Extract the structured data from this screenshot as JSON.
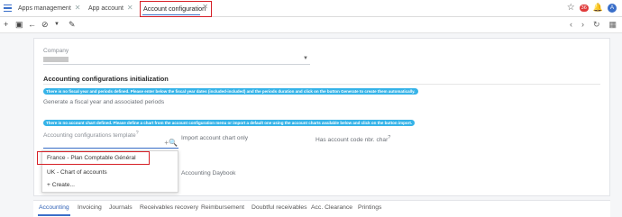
{
  "topbar": {
    "tabs": [
      {
        "label": "Apps management"
      },
      {
        "label": "App account"
      }
    ],
    "active_tab": {
      "label": "Account configuration"
    },
    "notification_count": "36",
    "avatar_initial": "A"
  },
  "form": {
    "company_label": "Company",
    "section_title": "Accounting configurations initialization",
    "info_fiscal": "There is no fiscal year and periods defined. Please enter below the fiscal year dates (included-included) and the periods duration and click on the button Generate to create them automatically.",
    "generate_label": "Generate a fiscal year and associated periods",
    "info_chart": "There is no account chart defined. Please define a chart from the account configuration menu or import a default one using the account charts available below and click on the button import.",
    "template_label": "Accounting configurations template",
    "template_help": "?",
    "import_label": "Import account chart only",
    "account_code_label": "Has account code nbr. char",
    "account_code_help": "?",
    "daybook_label": "Accounting Daybook"
  },
  "dropdown": {
    "options": [
      {
        "label": "France - Plan Comptable Général"
      },
      {
        "label": "UK - Chart of accounts"
      },
      {
        "label": "Create..."
      }
    ]
  },
  "bottom_tabs": [
    {
      "label": "Accounting"
    },
    {
      "label": "Invoicing"
    },
    {
      "label": "Journals"
    },
    {
      "label": "Receivables recovery"
    },
    {
      "label": "Reimbursement"
    },
    {
      "label": "Doubtful receivables"
    },
    {
      "label": "Acc. Clearance"
    },
    {
      "label": "Printings"
    }
  ],
  "colors": {
    "accent": "#3a6fc9",
    "highlight": "#d61f26",
    "info": "#35b3e8"
  }
}
